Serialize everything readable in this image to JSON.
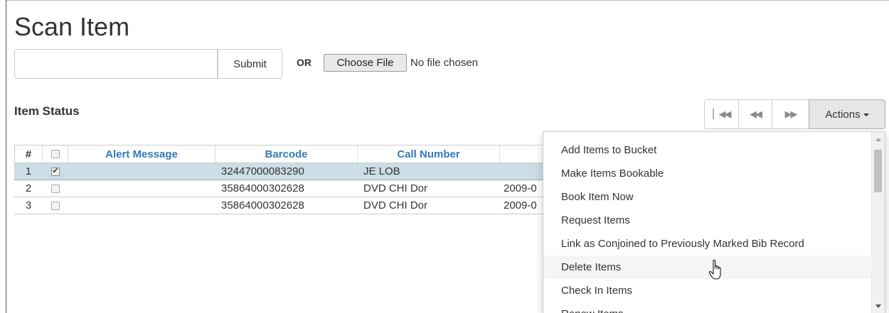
{
  "page": {
    "title": "Scan Item"
  },
  "scan_form": {
    "input_value": "",
    "submit_label": "Submit",
    "or_label": "OR",
    "choose_file_label": "Choose File",
    "file_status": "No file chosen"
  },
  "item_status": {
    "title": "Item Status",
    "pager": {
      "first_icon": "first-page-icon",
      "prev_icon": "previous-page-icon",
      "next_icon": "next-page-icon"
    },
    "actions_label": "Actions",
    "columns": {
      "num": "#",
      "alert": "Alert Message",
      "barcode": "Barcode",
      "call_number": "Call Number"
    },
    "rows": [
      {
        "num": "1",
        "selected": true,
        "alert": "",
        "barcode": "32447000083290",
        "call_number": "JE LOB",
        "partial": ""
      },
      {
        "num": "2",
        "selected": false,
        "alert": "",
        "barcode": "35864000302628",
        "call_number": "DVD CHI Dor",
        "partial": "2009-0"
      },
      {
        "num": "3",
        "selected": false,
        "alert": "",
        "barcode": "35864000302628",
        "call_number": "DVD CHI Dor",
        "partial": "2009-0"
      }
    ]
  },
  "actions_menu": {
    "items": [
      "Add Items to Bucket",
      "Make Items Bookable",
      "Book Item Now",
      "Request Items",
      "Link as Conjoined to Previously Marked Bib Record",
      "Delete Items",
      "Check In Items",
      "Renew Items"
    ],
    "hovered_index": 5
  },
  "colors": {
    "link": "#337ab7",
    "selected_row": "#cbdee5",
    "actions_bg": "#e6e6e6"
  }
}
